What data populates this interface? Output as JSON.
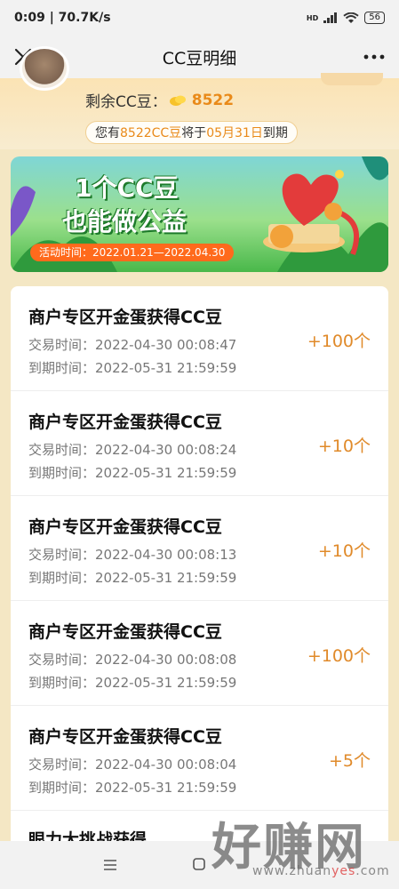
{
  "status": {
    "time_speed": "0:09 | 70.7K/s",
    "battery": "56",
    "hd_label": "HD"
  },
  "nav": {
    "title": "CC豆明细"
  },
  "header": {
    "balance_label": "剩余CC豆：",
    "balance_value": "8522",
    "expiry_prefix": "您有 ",
    "expiry_amount": "8522CC豆",
    "expiry_mid": " 将于 ",
    "expiry_date": "05月31日",
    "expiry_suffix": " 到期"
  },
  "banner": {
    "title_line1": "1个CC豆",
    "title_line2": "也能做公益",
    "date_text": "活动时间：2022.01.21—2022.04.30"
  },
  "records": [
    {
      "title": "商户专区开金蛋获得CC豆",
      "trade_time": "交易时间：2022-04-30 00:08:47",
      "expire_time": "到期时间：2022-05-31 21:59:59",
      "amount": "+100个"
    },
    {
      "title": "商户专区开金蛋获得CC豆",
      "trade_time": "交易时间：2022-04-30 00:08:24",
      "expire_time": "到期时间：2022-05-31 21:59:59",
      "amount": "+10个"
    },
    {
      "title": "商户专区开金蛋获得CC豆",
      "trade_time": "交易时间：2022-04-30 00:08:13",
      "expire_time": "到期时间：2022-05-31 21:59:59",
      "amount": "+10个"
    },
    {
      "title": "商户专区开金蛋获得CC豆",
      "trade_time": "交易时间：2022-04-30 00:08:08",
      "expire_time": "到期时间：2022-05-31 21:59:59",
      "amount": "+100个"
    },
    {
      "title": "商户专区开金蛋获得CC豆",
      "trade_time": "交易时间：2022-04-30 00:08:04",
      "expire_time": "到期时间：2022-05-31 21:59:59",
      "amount": "+5个"
    }
  ],
  "partial_record": {
    "title": "眼力大挑战获得"
  },
  "watermark": {
    "text": "好赚网",
    "url_a": "www.zhuan",
    "url_b": "yes",
    "url_c": ".com"
  },
  "colors": {
    "accent": "#e98a19",
    "amount": "#e08a2a"
  }
}
